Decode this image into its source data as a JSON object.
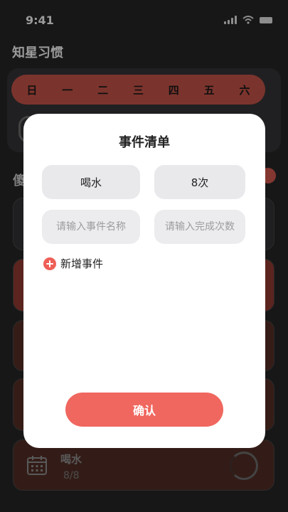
{
  "status_bar": {
    "time": "9:41"
  },
  "app": {
    "title": "知星习惯"
  },
  "week": {
    "days": [
      "日",
      "一",
      "二",
      "三",
      "四",
      "五",
      "六"
    ]
  },
  "section": {
    "label": "傻"
  },
  "habit_card": {
    "name": "喝水",
    "count": "8/8"
  },
  "modal": {
    "title": "事件清单",
    "events": [
      {
        "name": "喝水",
        "count": "8次"
      }
    ],
    "name_placeholder": "请输入事件名称",
    "count_placeholder": "请输入完成次数",
    "add_event_label": "新增事件",
    "confirm_label": "确认"
  },
  "colors": {
    "accent": "#f0675f",
    "modal_bg": "#ffffff",
    "field_bg": "#e9e9ec"
  }
}
